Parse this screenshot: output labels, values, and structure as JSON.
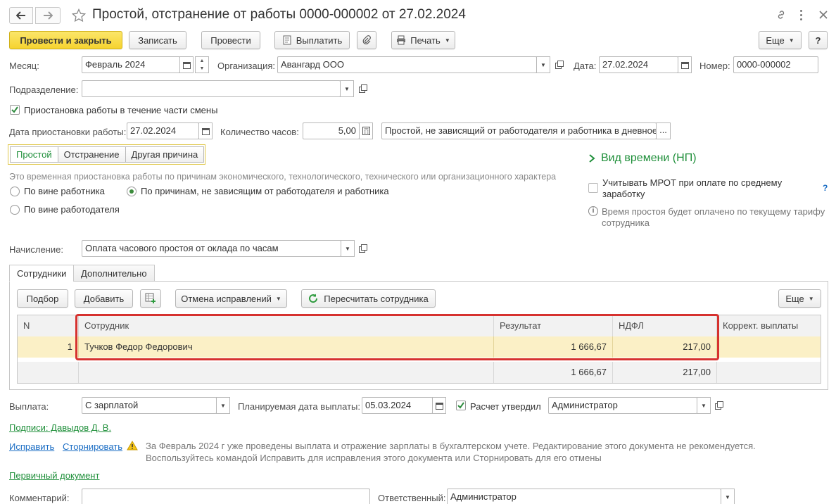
{
  "window": {
    "title": "Простой, отстранение от работы 0000-000002 от 27.02.2024",
    "back_icon": "arrow-left",
    "forward_icon": "arrow-right",
    "star_icon": "star",
    "link_icon": "link",
    "menu_icon": "more-vertical",
    "close_icon": "close"
  },
  "toolbar": {
    "post_close": "Провести и закрыть",
    "save": "Записать",
    "post": "Провести",
    "pay": "Выплатить",
    "print": "Печать",
    "more": "Еще",
    "help": "?"
  },
  "header": {
    "month_label": "Месяц:",
    "month_value": "Февраль 2024",
    "org_label": "Организация:",
    "org_value": "Авангард ООО",
    "date_label": "Дата:",
    "date_value": "27.02.2024",
    "number_label": "Номер:",
    "number_value": "0000-000002",
    "division_label": "Подразделение:",
    "division_value": ""
  },
  "suspension": {
    "partial_shift_label": "Приостановка работы в течение части смены",
    "partial_shift_checked": true,
    "date_label": "Дата приостановки работы:",
    "date_value": "27.02.2024",
    "hours_label": "Количество часов:",
    "hours_value": "5,00",
    "type_value": "Простой, не зависящий от работодателя и работника в дневное",
    "more": "..."
  },
  "reason_tabs": [
    "Простой",
    "Отстранение",
    "Другая причина"
  ],
  "reason": {
    "description": "Это временная приостановка работы по причинам экономического, технологического, технического или организационного характера",
    "options": [
      {
        "label": "По вине работника",
        "selected": false
      },
      {
        "label": "По причинам, не зависящим от работодателя и работника",
        "selected": true
      },
      {
        "label": "По вине работодателя",
        "selected": false
      }
    ]
  },
  "right_panel": {
    "time_kind_link": "Вид времени (НП)",
    "mrot_label": "Учитывать МРОТ при оплате по среднему заработку",
    "mrot_checked": false,
    "help": "?",
    "info_text": "Время простоя будет оплачено по текущему тарифу сотрудника"
  },
  "accrual": {
    "label": "Начисление:",
    "value": "Оплата часового простоя от оклада по часам"
  },
  "content_tabs": [
    "Сотрудники",
    "Дополнительно"
  ],
  "table_toolbar": {
    "select": "Подбор",
    "add": "Добавить",
    "cancel_fixes": "Отмена исправлений",
    "recalc": "Пересчитать сотрудника",
    "more": "Еще"
  },
  "table": {
    "columns": [
      "N",
      "Сотрудник",
      "Результат",
      "НДФЛ",
      "Коррект. выплаты"
    ],
    "rows": [
      {
        "n": "1",
        "employee": "Тучков Федор Федорович",
        "result": "1 666,67",
        "ndfl": "217,00",
        "correction": ""
      }
    ],
    "totals": {
      "result": "1 666,67",
      "ndfl": "217,00"
    }
  },
  "payment": {
    "label": "Выплата:",
    "value": "С зарплатой",
    "planned_label": "Планируемая дата выплаты:",
    "planned_value": "05.03.2024",
    "approved_label": "Расчет утвердил",
    "approved_checked": true,
    "approver_value": "Администратор"
  },
  "footer": {
    "signatures_link": "Подписи: Давыдов Д. В.",
    "fix_link": "Исправить",
    "storno_link": "Сторнировать",
    "warning_line1": "За Февраль 2024 г уже проведены выплата и отражение зарплаты в бухгалтерском учете. Редактирование этого документа не рекомендуется.",
    "warning_line2": "Воспользуйтесь командой Исправить для исправления этого документа или Сторнировать для его отмены",
    "primary_doc_link": "Первичный документ",
    "comment_label": "Комментарий:",
    "responsible_label": "Ответственный:",
    "responsible_value": "Администратор"
  },
  "colors": {
    "primary_button": "#f6d32f",
    "link_green": "#1f8f3a",
    "link_blue": "#1c6ec4",
    "row_highlight": "#fbf0c6",
    "highlight_border": "#d6322f"
  }
}
